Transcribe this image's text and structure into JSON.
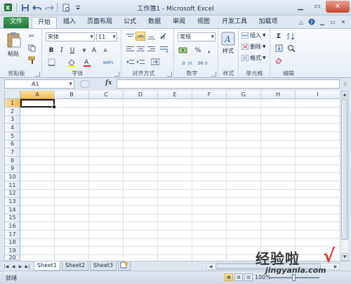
{
  "title": "工作簿1 - Microsoft Excel",
  "tabs": [
    "文件",
    "开始",
    "插入",
    "页面布局",
    "公式",
    "数据",
    "审阅",
    "视图",
    "开发工具",
    "加载项"
  ],
  "ribbon": {
    "clipboard": {
      "label": "剪贴板",
      "paste": "粘贴"
    },
    "font": {
      "label": "字体",
      "name": "宋体",
      "size": "11",
      "bold": "B",
      "italic": "I",
      "underline": "U",
      "grow": "A",
      "shrink": "A",
      "fontcolor": "A",
      "phonetic": "wén"
    },
    "align": {
      "label": "对齐方式"
    },
    "number": {
      "label": "数字",
      "format": "常规",
      "percent": "%",
      "comma": ","
    },
    "styles": {
      "label": "样式",
      "styles_btn": "样式"
    },
    "cells": {
      "label": "单元格",
      "insert": "插入",
      "delete": "删除",
      "format": "格式"
    },
    "editing": {
      "label": "编辑",
      "sum": "Σ"
    }
  },
  "formula_bar": {
    "name_box": "A1",
    "fx": "fx",
    "value": ""
  },
  "columns": [
    "A",
    "B",
    "C",
    "D",
    "E",
    "F",
    "G",
    "H",
    "I"
  ],
  "rows": [
    "1",
    "2",
    "3",
    "4",
    "5",
    "6",
    "7",
    "8",
    "9",
    "10",
    "11",
    "12",
    "13",
    "14",
    "15",
    "16",
    "17",
    "18",
    "19",
    "20"
  ],
  "sheets": [
    "Sheet1",
    "Sheet2",
    "Sheet3"
  ],
  "status": {
    "text": "就绪",
    "zoom": "100%"
  },
  "watermark": {
    "line1": "经验啦",
    "line2": "jingyanla.com",
    "mark": "√"
  },
  "colors": {
    "file_tab": "#1f7a3a",
    "selection": "#f1c15a",
    "close": "#c8452d"
  }
}
